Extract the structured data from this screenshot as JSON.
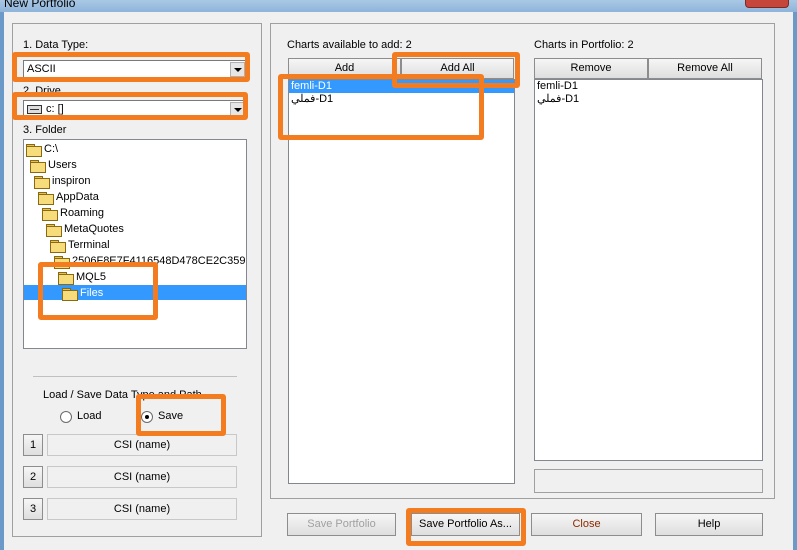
{
  "window": {
    "title": "New Portfolio"
  },
  "left": {
    "data_type_label": "1. Data Type:",
    "data_type_value": "ASCII",
    "drive_label": "2. Drive",
    "drive_value": "c: []",
    "folder_label": "3. Folder",
    "folders": [
      "C:\\",
      "Users",
      "inspiron",
      "AppData",
      "Roaming",
      "MetaQuotes",
      "Terminal",
      "2506F8E7F4116548D478CE2C359",
      "MQL5",
      "Files"
    ],
    "selected_folder": "Files",
    "load_save_label": "Load / Save Data Type and Path",
    "radio_load": "Load",
    "radio_save": "Save",
    "selected_mode": "Save",
    "presets": [
      {
        "num": "1",
        "text": "CSI (name)"
      },
      {
        "num": "2",
        "text": "CSI (name)"
      },
      {
        "num": "3",
        "text": "CSI (name)"
      }
    ]
  },
  "available": {
    "label": "Charts available to add: 2",
    "add_button": "Add",
    "add_all_button": "Add All",
    "items": [
      "femli-D1",
      "فملي-D1"
    ]
  },
  "portfolio": {
    "label": "Charts in Portfolio: 2",
    "remove_button": "Remove",
    "remove_all_button": "Remove All",
    "items": [
      "femli-D1",
      "فملي-D1"
    ]
  },
  "footer": {
    "save_portfolio": "Save Portfolio",
    "save_portfolio_as": "Save Portfolio As...",
    "close": "Close",
    "help": "Help"
  },
  "colors": {
    "highlight": "#f47c20",
    "selection": "#3399ff",
    "close_text": "#8b2a00"
  }
}
